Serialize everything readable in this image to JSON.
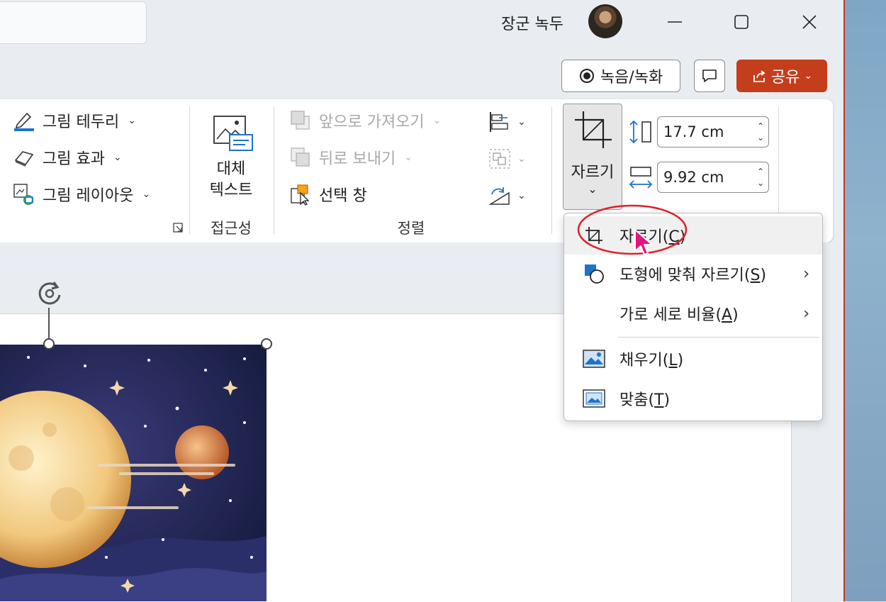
{
  "titlebar": {
    "user_name": "장군 녹두"
  },
  "top_buttons": {
    "record_label": "녹음/녹화",
    "share_label": "공유"
  },
  "ribbon": {
    "picture_styles": {
      "border_label": "그림 테두리",
      "effects_label": "그림 효과",
      "layout_label": "그림 레이아웃"
    },
    "accessibility": {
      "alt_text_line1": "대체",
      "alt_text_line2": "텍스트",
      "group_label": "접근성"
    },
    "arrange": {
      "bring_forward_label": "앞으로 가져오기",
      "send_backward_label": "뒤로 보내기",
      "selection_pane_label": "선택 창",
      "group_label": "정렬"
    },
    "size": {
      "crop_label": "자르기",
      "height_value": "17.7 cm",
      "width_value": "9.92 cm"
    }
  },
  "crop_menu": {
    "items": [
      {
        "label": "자르기",
        "key": "C",
        "has_submenu": false
      },
      {
        "label": "도형에 맞춰 자르기",
        "key": "S",
        "has_submenu": true
      },
      {
        "label": "가로 세로 비율",
        "key": "A",
        "has_submenu": true
      },
      {
        "label": "채우기",
        "key": "L",
        "has_submenu": false
      },
      {
        "label": "맞춤",
        "key": "T",
        "has_submenu": false
      }
    ]
  },
  "colors": {
    "share_button": "#c43e1c",
    "accent_blue": "#1e73c8",
    "highlight_circle": "#e0202a",
    "cursor": "#e4137f"
  }
}
